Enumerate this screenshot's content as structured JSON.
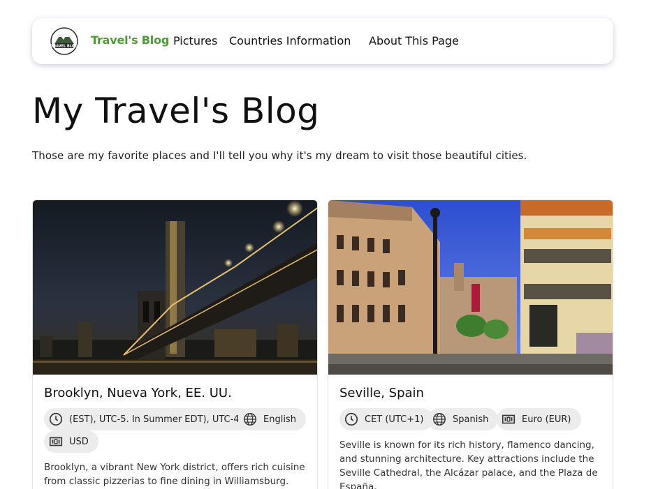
{
  "nav": {
    "logo_text": "TRAVEL BLOG",
    "brand": "Travel's Blog",
    "links": [
      "Pictures",
      "Countries Information",
      "About This Page"
    ]
  },
  "page": {
    "title": "My Travel's Blog",
    "intro": "Those are my favorite places and I'll tell you why it's my dream to visit those beautiful cities."
  },
  "cards": [
    {
      "title": "Brooklyn, Nueva York, EE. UU.",
      "timezone": "(EST), UTC-5. In Summer EDT), UTC-4.",
      "language": "English",
      "currency": "USD",
      "description": "Brooklyn, a vibrant New York district, offers rich cuisine from classic pizzerias to fine dining in Williamsburg. Visit"
    },
    {
      "title": "Seville, Spain",
      "timezone": "CET (UTC+1)",
      "language": "Spanish",
      "currency": "Euro (EUR)",
      "description": "Seville is known for its rich history, flamenco dancing, and stunning architecture. Key attractions include the Seville Cathedral, the Alcázar palace, and the Plaza de España."
    }
  ],
  "icons": {
    "timezone": "clock-icon",
    "language": "globe-icon",
    "currency": "banknote-icon"
  },
  "colors": {
    "brand": "#4a9a36",
    "chip_bg": "#ececec"
  }
}
